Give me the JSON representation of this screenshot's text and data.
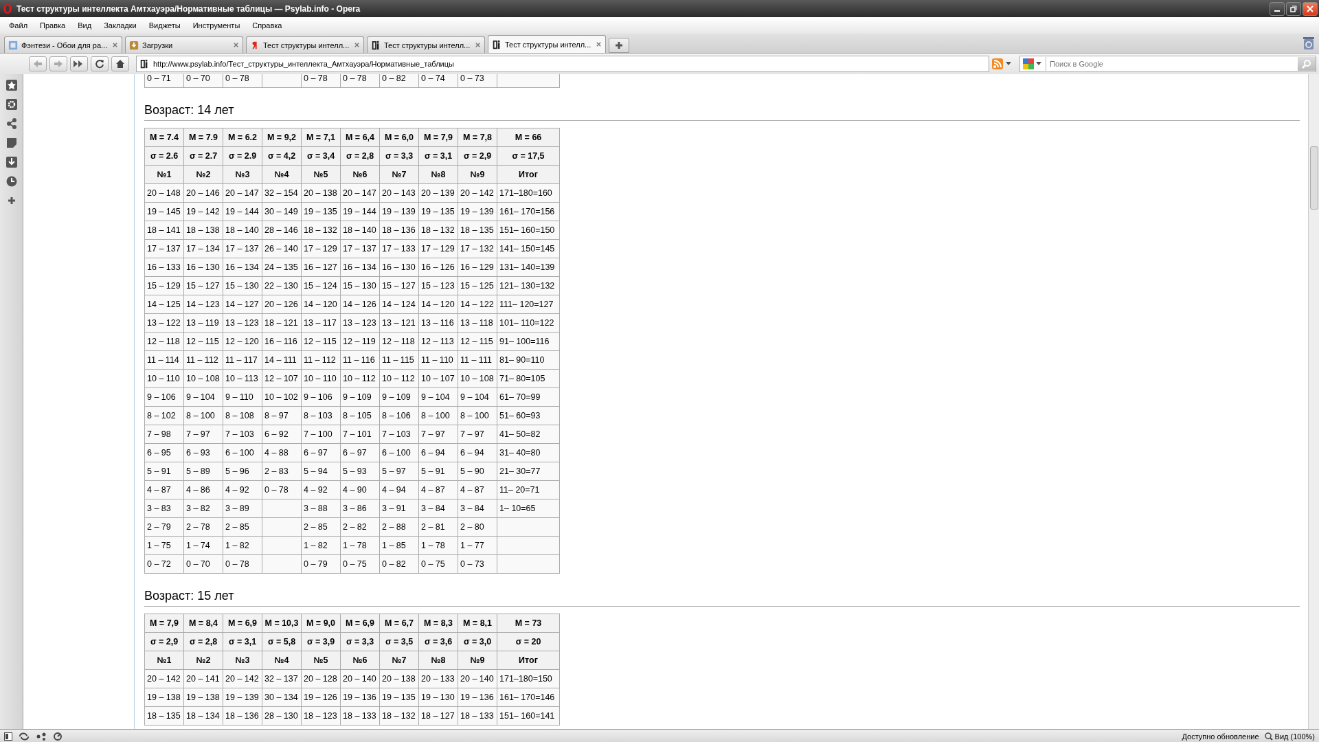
{
  "window": {
    "title": "Тест структуры интеллекта Амтхауэра/Нормативные таблицы — Psylab.info - Opera"
  },
  "menu": [
    "Файл",
    "Правка",
    "Вид",
    "Закладки",
    "Виджеты",
    "Инструменты",
    "Справка"
  ],
  "tabs": [
    {
      "label": "Фэнтези - Обои для ра...",
      "selected": false
    },
    {
      "label": "Загрузки",
      "selected": false
    },
    {
      "label": "Тест структуры интелл...",
      "selected": false
    },
    {
      "label": "Тест структуры интелл...",
      "selected": false
    },
    {
      "label": "Тест структуры интелл...",
      "selected": true
    }
  ],
  "address": {
    "value": "http://www.psylab.info/Тест_структуры_интеллекта_Амтхауэра/Нормативные_таблицы"
  },
  "search": {
    "placeholder": "Поиск в Google"
  },
  "sections": [
    {
      "rows": [
        [
          "0 – 71",
          "0 – 70",
          "0 – 78",
          "",
          "0 – 78",
          "0 – 78",
          "0 – 82",
          "0 – 74",
          "0 – 73",
          ""
        ]
      ]
    },
    {
      "heading": "Возраст: 14 лет",
      "means": [
        "M = 7.4",
        "M = 7.9",
        "M = 6.2",
        "M = 9,2",
        "M = 7,1",
        "M = 6,4",
        "M = 6,0",
        "M = 7,9",
        "M = 7,8",
        "M = 66"
      ],
      "sigmas": [
        "σ = 2.6",
        "σ = 2.7",
        "σ = 2.9",
        "σ = 4,2",
        "σ = 3,4",
        "σ = 2,8",
        "σ = 3,3",
        "σ = 3,1",
        "σ = 2,9",
        "σ = 17,5"
      ],
      "headers": [
        "№1",
        "№2",
        "№3",
        "№4",
        "№5",
        "№6",
        "№7",
        "№8",
        "№9",
        "Итог"
      ],
      "rows": [
        [
          "20 – 148",
          "20 – 146",
          "20 – 147",
          "32 – 154",
          "20 – 138",
          "20 – 147",
          "20 – 143",
          "20 – 139",
          "20 – 142",
          "171–180=160"
        ],
        [
          "19 – 145",
          "19 – 142",
          "19 – 144",
          "30 – 149",
          "19 – 135",
          "19 – 144",
          "19 – 139",
          "19 – 135",
          "19 – 139",
          "161– 170=156"
        ],
        [
          "18 – 141",
          "18 – 138",
          "18 – 140",
          "28 – 146",
          "18 – 132",
          "18 – 140",
          "18 – 136",
          "18 – 132",
          "18 – 135",
          "151– 160=150"
        ],
        [
          "17 – 137",
          "17 – 134",
          "17 – 137",
          "26 – 140",
          "17 – 129",
          "17 – 137",
          "17 – 133",
          "17 – 129",
          "17 – 132",
          "141– 150=145"
        ],
        [
          "16 – 133",
          "16 – 130",
          "16 – 134",
          "24 – 135",
          "16 – 127",
          "16 – 134",
          "16 – 130",
          "16 – 126",
          "16 – 129",
          "131– 140=139"
        ],
        [
          "15 – 129",
          "15 – 127",
          "15 – 130",
          "22 – 130",
          "15 – 124",
          "15 – 130",
          "15 – 127",
          "15 – 123",
          "15 – 125",
          "121– 130=132"
        ],
        [
          "14 – 125",
          "14 – 123",
          "14 – 127",
          "20 – 126",
          "14 – 120",
          "14 – 126",
          "14 – 124",
          "14 – 120",
          "14 – 122",
          "111– 120=127"
        ],
        [
          "13 – 122",
          "13 – 119",
          "13 – 123",
          "18 – 121",
          "13 – 117",
          "13 – 123",
          "13 – 121",
          "13 – 116",
          "13 – 118",
          "101– 110=122"
        ],
        [
          "12 – 118",
          "12 – 115",
          "12 – 120",
          "16 – 116",
          "12 – 115",
          "12 – 119",
          "12 – 118",
          "12 – 113",
          "12 – 115",
          "91– 100=116"
        ],
        [
          "11 – 114",
          "11 – 112",
          "11 – 117",
          "14 – 111",
          "11 – 112",
          "11 – 116",
          "11 – 115",
          "11 – 110",
          "11 – 111",
          "81– 90=110"
        ],
        [
          "10 – 110",
          "10 – 108",
          "10 – 113",
          "12 – 107",
          "10 – 110",
          "10 – 112",
          "10 – 112",
          "10 – 107",
          "10 – 108",
          "71– 80=105"
        ],
        [
          "9 – 106",
          "9 – 104",
          "9 – 110",
          "10 – 102",
          "9 – 106",
          "9 – 109",
          "9 – 109",
          "9 – 104",
          "9 – 104",
          "61– 70=99"
        ],
        [
          "8 – 102",
          "8 – 100",
          "8 – 108",
          "8 – 97",
          "8 – 103",
          "8 – 105",
          "8 – 106",
          "8 – 100",
          "8 – 100",
          "51– 60=93"
        ],
        [
          "7 – 98",
          "7 – 97",
          "7 – 103",
          "6 – 92",
          "7 – 100",
          "7 – 101",
          "7 – 103",
          "7 – 97",
          "7 – 97",
          "41– 50=82"
        ],
        [
          "6 – 95",
          "6 – 93",
          "6 – 100",
          "4 – 88",
          "6 – 97",
          "6 – 97",
          "6 – 100",
          "6 – 94",
          "6 – 94",
          "31– 40=80"
        ],
        [
          "5 – 91",
          "5 – 89",
          "5 – 96",
          "2 – 83",
          "5 – 94",
          "5 – 93",
          "5 – 97",
          "5 – 91",
          "5 – 90",
          "21– 30=77"
        ],
        [
          "4 – 87",
          "4 – 86",
          "4 – 92",
          "0 – 78",
          "4 – 92",
          "4 – 90",
          "4 – 94",
          "4 – 87",
          "4 – 87",
          "11– 20=71"
        ],
        [
          "3 – 83",
          "3 – 82",
          "3 – 89",
          "",
          "3 – 88",
          "3 – 86",
          "3 – 91",
          "3 – 84",
          "3 – 84",
          "1– 10=65"
        ],
        [
          "2 – 79",
          "2 – 78",
          "2 – 85",
          "",
          "2 – 85",
          "2 – 82",
          "2 – 88",
          "2 – 81",
          "2 – 80",
          ""
        ],
        [
          "1 – 75",
          "1 – 74",
          "1 – 82",
          "",
          "1 – 82",
          "1 – 78",
          "1 – 85",
          "1 – 78",
          "1 – 77",
          ""
        ],
        [
          "0 – 72",
          "0 – 70",
          "0 – 78",
          "",
          "0 – 79",
          "0 – 75",
          "0 – 82",
          "0 – 75",
          "0 – 73",
          ""
        ]
      ]
    },
    {
      "heading": "Возраст: 15 лет",
      "means": [
        "M = 7,9",
        "M = 8,4",
        "M = 6,9",
        "M = 10,3",
        "M = 9,0",
        "M = 6,9",
        "M = 6,7",
        "M = 8,3",
        "M = 8,1",
        "M = 73"
      ],
      "sigmas": [
        "σ = 2,9",
        "σ = 2,8",
        "σ = 3,1",
        "σ = 5,8",
        "σ = 3,9",
        "σ = 3,3",
        "σ = 3,5",
        "σ = 3,6",
        "σ = 3,0",
        "σ = 20"
      ],
      "headers": [
        "№1",
        "№2",
        "№3",
        "№4",
        "№5",
        "№6",
        "№7",
        "№8",
        "№9",
        "Итог"
      ],
      "rows": [
        [
          "20 – 142",
          "20 – 141",
          "20 – 142",
          "32 – 137",
          "20 – 128",
          "20 – 140",
          "20 – 138",
          "20 – 133",
          "20 – 140",
          "171–180=150"
        ],
        [
          "19 – 138",
          "19 – 138",
          "19 – 139",
          "30 – 134",
          "19 – 126",
          "19 – 136",
          "19 – 135",
          "19 – 130",
          "19 – 136",
          "161– 170=146"
        ],
        [
          "18 – 135",
          "18 – 134",
          "18 – 136",
          "28 – 130",
          "18 – 123",
          "18 – 133",
          "18 – 132",
          "18 – 127",
          "18 – 133",
          "151– 160=141"
        ]
      ]
    }
  ],
  "status": {
    "update": "Доступно обновление",
    "zoom": "Вид (100%)"
  }
}
